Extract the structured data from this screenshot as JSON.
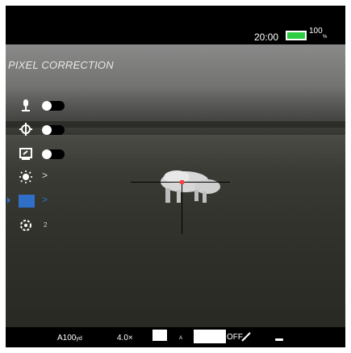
{
  "status": {
    "time": "20:00",
    "battery_percent": "100",
    "battery_unit": "%",
    "battery_level": 1.0,
    "battery_color": "#2ecc40"
  },
  "menu": {
    "title": "PIXEL CORRECTION",
    "items": [
      {
        "icon": "microphone-icon",
        "control": "toggle",
        "state": "off"
      },
      {
        "icon": "stabilization-icon",
        "control": "toggle",
        "state": "off"
      },
      {
        "icon": "screen-icon",
        "control": "toggle",
        "state": "off"
      },
      {
        "icon": "brightness-icon",
        "control": "arrow",
        "arrow": ">"
      },
      {
        "icon": "pixel-correction-icon",
        "control": "arrow",
        "arrow": ">",
        "selected": true
      },
      {
        "icon": "settings-icon",
        "control": "label",
        "label": "2"
      }
    ],
    "accent_color": "#2f6fc8"
  },
  "reticle": {
    "color": "#000000",
    "center_color": "#ff3b3b"
  },
  "bottom": {
    "range": "A100",
    "range_unit": "yd",
    "zoom": "4.0×",
    "auto_label": "A",
    "wifi": "OFF"
  }
}
